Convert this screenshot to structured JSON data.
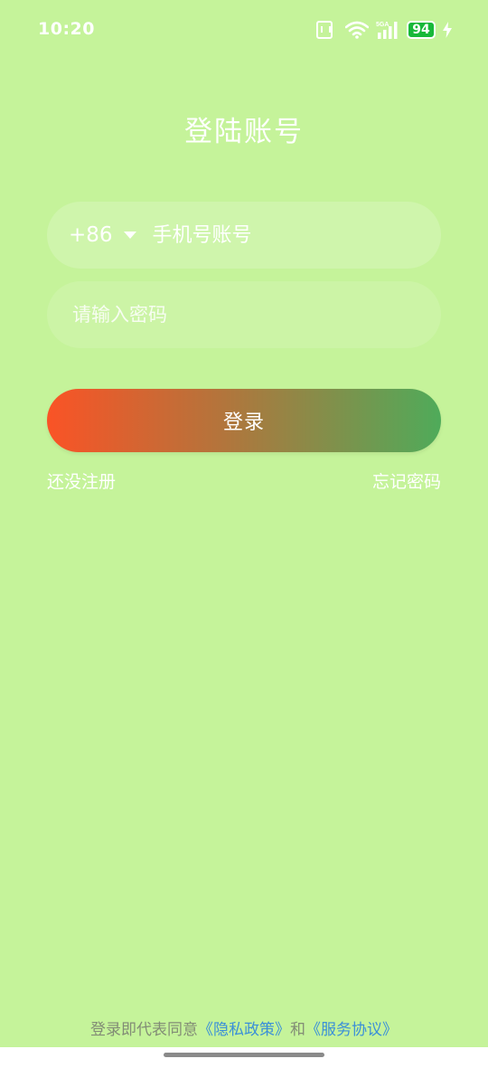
{
  "status_bar": {
    "time": "10:20",
    "battery": "94",
    "signal_label": "5GA",
    "icons": [
      "nfc-icon",
      "wifi-icon",
      "signal-icon",
      "battery-icon",
      "charging-icon"
    ]
  },
  "title": "登陆账号",
  "phone": {
    "country_code": "+86",
    "placeholder": "手机号账号"
  },
  "password": {
    "placeholder": "请输入密码"
  },
  "login_label": "登录",
  "register_label": "还没注册",
  "forgot_label": "忘记密码",
  "agreement": {
    "prefix": "登录即代表同意",
    "privacy": "《隐私政策》",
    "and": "和",
    "terms": "《服务协议》"
  },
  "colors": {
    "background": "#c5f39a",
    "button_gradient_start": "#fa5326",
    "button_gradient_end": "#4fab5a",
    "link": "#3a8fd8",
    "battery": "#18b839"
  }
}
